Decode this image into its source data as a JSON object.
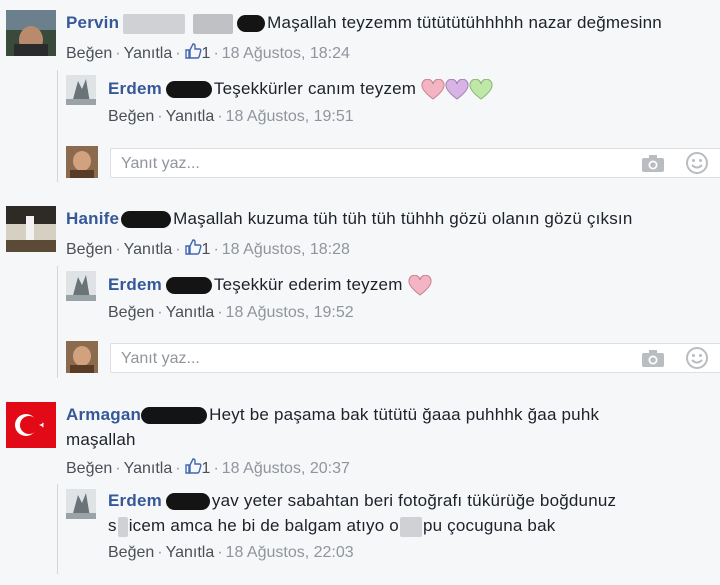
{
  "actions": {
    "like": "Beğen",
    "reply": "Yanıtla",
    "sep": "·"
  },
  "reply_input": {
    "placeholder": "Yanıt yaz..."
  },
  "threads": [
    {
      "comment": {
        "author": "Pervin",
        "text": "Maşallah teyzemm tütütütühhhhh nazar değmesinn",
        "likes": "1",
        "date": "18 Ağustos, 18:24"
      },
      "reply": {
        "author": "Erdem",
        "text": "Teşekkürler canım teyzem",
        "date": "18 Ağustos, 19:51",
        "hearts": [
          "#f3b4c4",
          "#d8b3e6",
          "#bfe8a8"
        ]
      }
    },
    {
      "comment": {
        "author": "Hanife",
        "text": "Maşallah kuzuma tüh tüh tüh tühhh gözü olanın gözü çıksın",
        "likes": "1",
        "date": "18 Ağustos, 18:28"
      },
      "reply": {
        "author": "Erdem",
        "text": "Teşekkür ederim teyzem",
        "date": "18 Ağustos, 19:52",
        "hearts": [
          "#f3b4c4"
        ]
      }
    },
    {
      "comment": {
        "author": "Armagan",
        "text_line1": "Heyt be paşama bak tütütü ğaaa puhhhk ğaa puhk",
        "text_line2": "maşallah",
        "likes": "1",
        "date": "18 Ağustos, 20:37"
      },
      "reply": {
        "author": "Erdem",
        "text_line1": "yav yeter sabahtan beri fotoğrafı tükürüğe boğdunuz",
        "text_line2_a": "s",
        "text_line2_b": "icem amca he bi de balgam atıyo o",
        "text_line2_c": "pu çocuguna bak",
        "date": "18 Ağustos, 22:03"
      }
    }
  ]
}
